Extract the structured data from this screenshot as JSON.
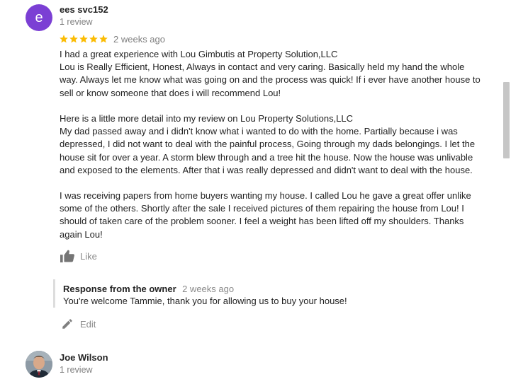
{
  "review1": {
    "avatar_letter": "e",
    "avatar_color": "#7b3fd4",
    "reviewer_name": "ees svc152",
    "review_count": "1 review",
    "rating_stars": 5,
    "star_color": "#fbbc04",
    "time": "2 weeks ago",
    "body_lines": [
      "I had a great experience with Lou Gimbutis  at Property Solution,LLC",
      "Lou is  Really Efficient, Honest, Always in contact and very caring. Basically held my hand the whole",
      "way. Always let me know what was going on and the process was quick!  If i ever have another house to",
      "sell or know someone that does i will recommend Lou!",
      "",
      "Here is a little more detail into my review on Lou Property Solutions,LLC",
      "My dad passed away and i didn't know what i wanted to do with the home. Partially because i was",
      "depressed, I did not want to deal with the painful process, Going through my dads belongings. I let the",
      "house sit for over a year. A storm blew through and a  tree hit the house.  Now the house was unlivable",
      "and exposed to the elements. After that i was really depressed and didn't want to deal with the house.",
      "",
      "I was receiving papers from home buyers wanting my house. I called Lou he gave a great offer unlike",
      "some of the others. Shortly after the sale I received pictures of them repairing the house from Lou!  I",
      "should of taken care of the problem sooner. I feel a weight has been lifted off my shoulders. Thanks",
      "again Lou!"
    ],
    "like_label": "Like",
    "like_icon": "thumbs-up-icon",
    "owner_response": {
      "heading": "Response from the owner",
      "time": "2 weeks ago",
      "text": "You're welcome Tammie, thank you for allowing us to buy your house!"
    },
    "edit_label": "Edit",
    "edit_icon": "pencil-icon"
  },
  "review2": {
    "reviewer_name": "Joe Wilson",
    "review_count": "1 review"
  }
}
